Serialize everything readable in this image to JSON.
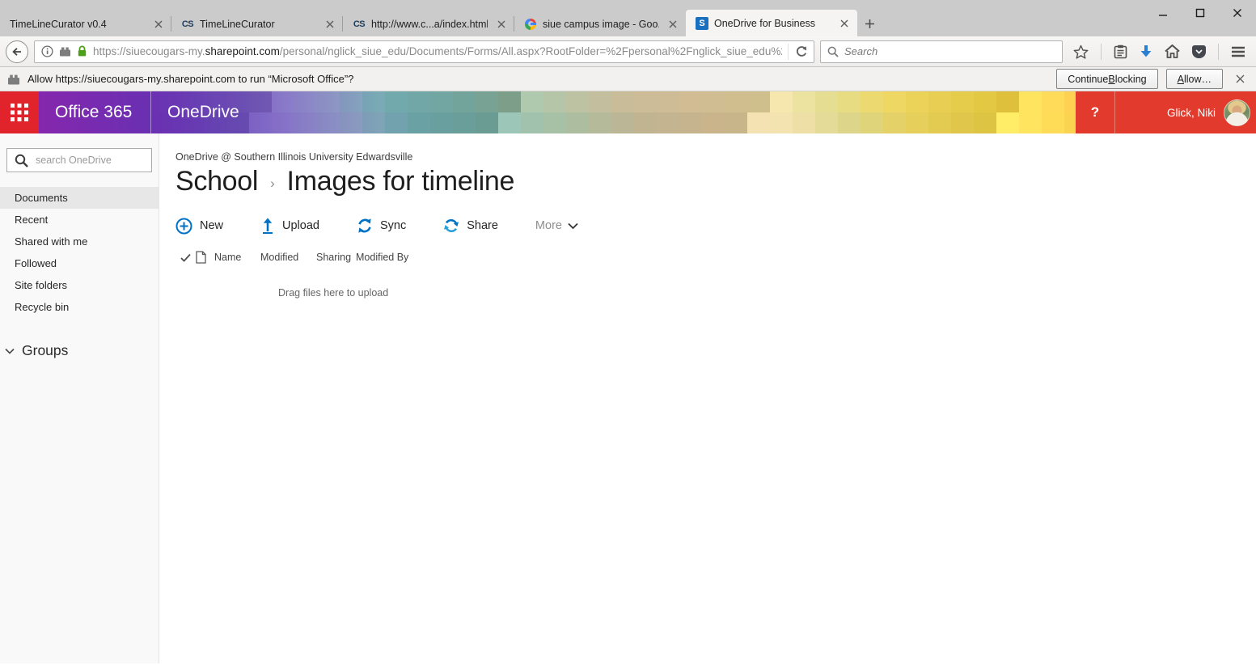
{
  "browser": {
    "tabs": [
      {
        "label": "TimeLineCurator v0.4",
        "favicon": "",
        "active": false
      },
      {
        "label": "TimeLineCurator",
        "favicon": "CS",
        "active": false
      },
      {
        "label": "http://www.c...a/index.html",
        "favicon": "CS",
        "active": false
      },
      {
        "label": "siue campus image - Goo...",
        "favicon": "G",
        "active": false
      },
      {
        "label": "OneDrive for Business",
        "favicon": "S",
        "active": true
      }
    ],
    "urlbar": {
      "url_prefix": "https://siuecougars-my.",
      "url_domain": "sharepoint.com",
      "url_path": "/personal/nglick_siue_edu/Documents/Forms/All.aspx?RootFolder=%2Fpersonal%2Fnglick_siue_edu%2"
    },
    "search": {
      "placeholder": "Search"
    }
  },
  "notification": {
    "message": "Allow https://siuecougars-my.sharepoint.com to run “Microsoft Office”?",
    "continue_button": {
      "pre": "Continue ",
      "key": "B",
      "post": "locking"
    },
    "allow_button": {
      "pre": "",
      "key": "A",
      "post": "llow…"
    }
  },
  "suitebar": {
    "brand": "Office 365",
    "app": "OneDrive",
    "help_label": "?",
    "user_name": "Glick, Niki"
  },
  "sidebar": {
    "search_placeholder": "search OneDrive",
    "items": [
      {
        "label": "Documents",
        "selected": true
      },
      {
        "label": "Recent",
        "selected": false
      },
      {
        "label": "Shared with me",
        "selected": false
      },
      {
        "label": "Followed",
        "selected": false
      },
      {
        "label": "Site folders",
        "selected": false
      },
      {
        "label": "Recycle bin",
        "selected": false
      }
    ],
    "groups_label": "Groups"
  },
  "main": {
    "org_title": "OneDrive @ Southern Illinois University Edwardsville",
    "breadcrumb": {
      "parent": "School",
      "separator": "›",
      "current": "Images for timeline"
    },
    "commands": {
      "new": "New",
      "upload": "Upload",
      "sync": "Sync",
      "share": "Share",
      "more": "More"
    },
    "table": {
      "headers": [
        "Name",
        "Modified",
        "Sharing",
        "Modified By"
      ]
    },
    "empty_message": "Drag files here to upload"
  },
  "colors": {
    "accent_blue": "#0072c6",
    "suitebar_red": "#e23a2c",
    "launcher_red": "#e1232b"
  }
}
